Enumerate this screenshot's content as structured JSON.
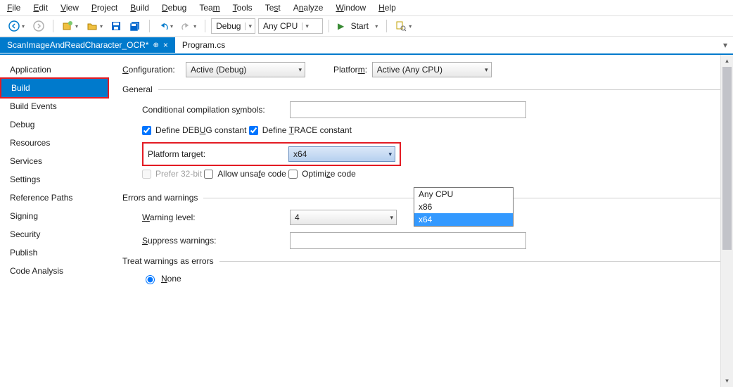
{
  "menu": {
    "file": "File",
    "edit": "Edit",
    "view": "View",
    "project": "Project",
    "build": "Build",
    "debug": "Debug",
    "team": "Team",
    "tools": "Tools",
    "test": "Test",
    "analyze": "Analyze",
    "window": "Window",
    "help": "Help"
  },
  "toolbar": {
    "config": "Debug",
    "platform": "Any CPU",
    "start": "Start"
  },
  "tabs": {
    "active": "ScanImageAndReadCharacter_OCR*",
    "inactive": "Program.cs"
  },
  "sidebar": {
    "items": [
      "Application",
      "Build",
      "Build Events",
      "Debug",
      "Resources",
      "Services",
      "Settings",
      "Reference Paths",
      "Signing",
      "Security",
      "Publish",
      "Code Analysis"
    ]
  },
  "cfg": {
    "configLabel": "Configuration:",
    "configValue": "Active (Debug)",
    "platLabel": "Platform:",
    "platValue": "Active (Any CPU)"
  },
  "general": {
    "head": "General",
    "condSym": "Conditional compilation symbols:",
    "defDebug": "Define DEBUG constant",
    "defTrace": "Define TRACE constant",
    "platformTarget": "Platform target:",
    "ptValue": "x64",
    "ptOptions": [
      "Any CPU",
      "x86",
      "x64"
    ],
    "prefer32": "Prefer 32-bit",
    "allowUnsafe": "Allow unsafe code",
    "optimize": "Optimize code"
  },
  "errwarn": {
    "head": "Errors and warnings",
    "warnLevel": "Warning level:",
    "warnValue": "4",
    "suppress": "Suppress warnings:"
  },
  "treat": {
    "head": "Treat warnings as errors",
    "none": "None"
  }
}
